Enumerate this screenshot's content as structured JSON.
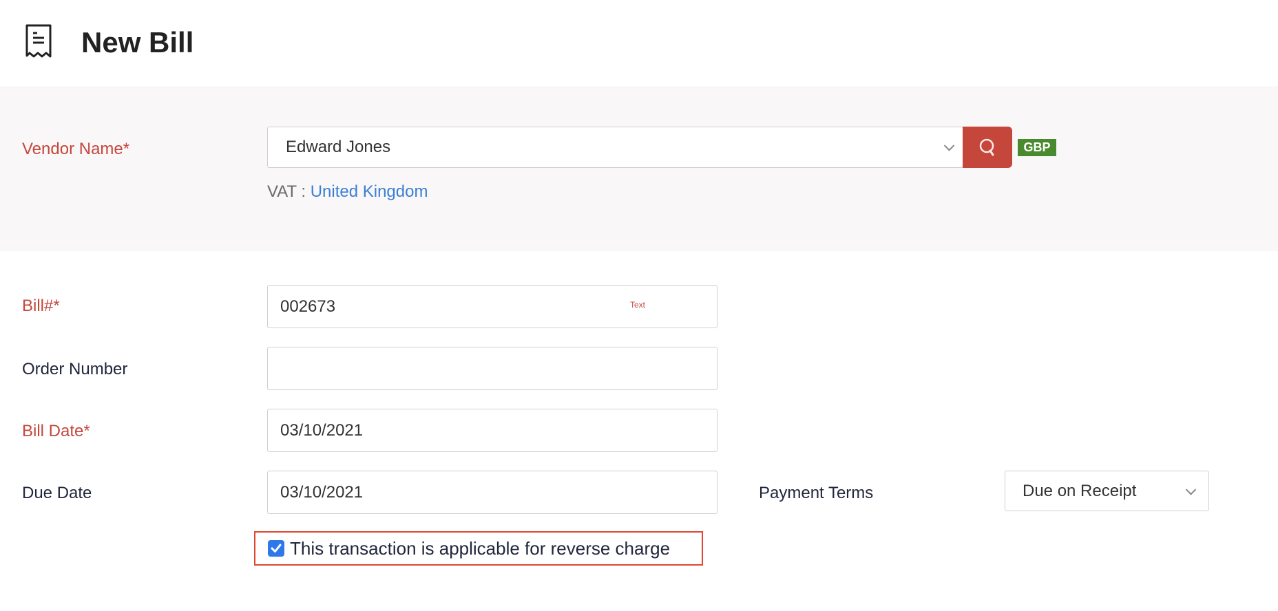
{
  "header": {
    "title": "New Bill",
    "icon": "receipt-icon"
  },
  "vendor": {
    "label": "Vendor Name*",
    "value": "Edward Jones",
    "currency": "GBP",
    "vat_label": "VAT :",
    "vat_value": "United Kingdom"
  },
  "form": {
    "bill_label": "Bill#*",
    "bill_value": "002673",
    "bill_hint": "Text",
    "order_label": "Order Number",
    "order_value": "",
    "bill_date_label": "Bill Date*",
    "bill_date_value": "03/10/2021",
    "due_date_label": "Due Date",
    "due_date_value": "03/10/2021",
    "payment_terms_label": "Payment Terms",
    "payment_terms_value": "Due on Receipt",
    "reverse_charge_label": "This transaction is applicable for reverse charge",
    "reverse_charge_checked": true
  },
  "colors": {
    "required": "#c5473c",
    "accent": "#c5473c",
    "currency_badge": "#4a8a2e",
    "link": "#3a7fd5",
    "highlight": "#e0462f",
    "checkbox": "#2f78ea"
  }
}
